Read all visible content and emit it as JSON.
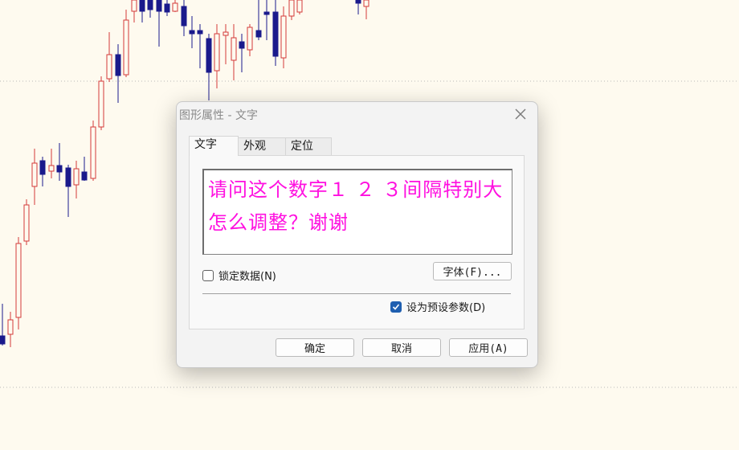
{
  "dialog": {
    "title": "图形属性 - 文字",
    "tabs": [
      {
        "label": "文字",
        "active": true
      },
      {
        "label": "外观",
        "active": false
      },
      {
        "label": "定位",
        "active": false
      }
    ],
    "text_value": "请问这个数字１ ２ ３间隔特别大怎么调整？谢谢",
    "text_color": "#ff10e0",
    "lock_label": "锁定数据(N)",
    "lock_checked": false,
    "font_button": "字体(F)...",
    "default_label": "设为预设参数(D)",
    "default_checked": true,
    "ok_button": "确定",
    "cancel_button": "取消",
    "apply_button": "应用(A)"
  },
  "colors": {
    "background": "#fefaef",
    "candle_up": "#d43a3a",
    "candle_down": "#1a1a8c",
    "accent": "#1f5fb0"
  },
  "icons": [
    "close-icon",
    "check-icon"
  ]
}
